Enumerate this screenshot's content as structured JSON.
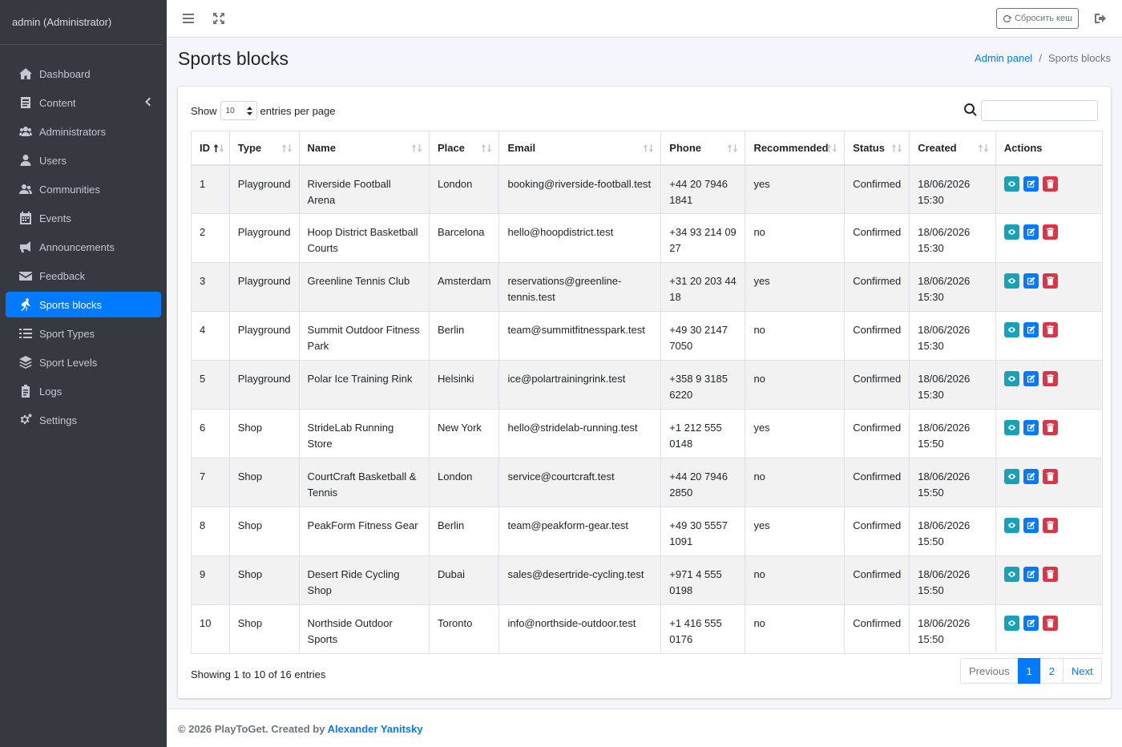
{
  "sidebar": {
    "user": "admin (Administrator)",
    "items": [
      {
        "label": "Dashboard",
        "icon": "home-icon"
      },
      {
        "label": "Content",
        "icon": "content-icon"
      },
      {
        "label": "Administrators",
        "icon": "users-cog-icon"
      },
      {
        "label": "Users",
        "icon": "user-icon"
      },
      {
        "label": "Communities",
        "icon": "users-icon"
      },
      {
        "label": "Events",
        "icon": "calendar-icon"
      },
      {
        "label": "Announcements",
        "icon": "bullhorn-icon"
      },
      {
        "label": "Feedback",
        "icon": "envelope-icon"
      },
      {
        "label": "Sports blocks",
        "icon": "running-icon"
      },
      {
        "label": "Sport Types",
        "icon": "list-icon"
      },
      {
        "label": "Sport Levels",
        "icon": "layers-icon"
      },
      {
        "label": "Logs",
        "icon": "clipboard-icon"
      },
      {
        "label": "Settings",
        "icon": "cogs-icon"
      }
    ]
  },
  "topbar": {
    "cache_button": "Сбросить кеш"
  },
  "header": {
    "title": "Sports blocks",
    "breadcrumb": {
      "link": "Admin panel",
      "separator": "/",
      "current": "Sports blocks"
    }
  },
  "table_controls": {
    "show": "Show",
    "entries_value": "10",
    "entries_suffix": "entries per page"
  },
  "table": {
    "columns": [
      "ID",
      "Type",
      "Name",
      "Place",
      "Email",
      "Phone",
      "Recommended",
      "Status",
      "Created",
      "Actions"
    ],
    "rows": [
      {
        "id": "1",
        "type": "Playground",
        "name": "Riverside Football Arena",
        "place": "London",
        "email": "booking@riverside-football.test",
        "phone": "+44 20 7946 1841",
        "recommended": "yes",
        "status": "Confirmed",
        "created": "18/06/2026 15:30"
      },
      {
        "id": "2",
        "type": "Playground",
        "name": "Hoop District Basketball Courts",
        "place": "Barcelona",
        "email": "hello@hoopdistrict.test",
        "phone": "+34 93 214 09 27",
        "recommended": "no",
        "status": "Confirmed",
        "created": "18/06/2026 15:30"
      },
      {
        "id": "3",
        "type": "Playground",
        "name": "Greenline Tennis Club",
        "place": "Amsterdam",
        "email": "reservations@greenline-tennis.test",
        "phone": "+31 20 203 44 18",
        "recommended": "yes",
        "status": "Confirmed",
        "created": "18/06/2026 15:30"
      },
      {
        "id": "4",
        "type": "Playground",
        "name": "Summit Outdoor Fitness Park",
        "place": "Berlin",
        "email": "team@summitfitnesspark.test",
        "phone": "+49 30 2147 7050",
        "recommended": "no",
        "status": "Confirmed",
        "created": "18/06/2026 15:30"
      },
      {
        "id": "5",
        "type": "Playground",
        "name": "Polar Ice Training Rink",
        "place": "Helsinki",
        "email": "ice@polartrainingrink.test",
        "phone": "+358 9 3185 6220",
        "recommended": "no",
        "status": "Confirmed",
        "created": "18/06/2026 15:30"
      },
      {
        "id": "6",
        "type": "Shop",
        "name": "StrideLab Running Store",
        "place": "New York",
        "email": "hello@stridelab-running.test",
        "phone": "+1 212 555 0148",
        "recommended": "yes",
        "status": "Confirmed",
        "created": "18/06/2026 15:50"
      },
      {
        "id": "7",
        "type": "Shop",
        "name": "CourtCraft Basketball & Tennis",
        "place": "London",
        "email": "service@courtcraft.test",
        "phone": "+44 20 7946 2850",
        "recommended": "no",
        "status": "Confirmed",
        "created": "18/06/2026 15:50"
      },
      {
        "id": "8",
        "type": "Shop",
        "name": "PeakForm Fitness Gear",
        "place": "Berlin",
        "email": "team@peakform-gear.test",
        "phone": "+49 30 5557 1091",
        "recommended": "yes",
        "status": "Confirmed",
        "created": "18/06/2026 15:50"
      },
      {
        "id": "9",
        "type": "Shop",
        "name": "Desert Ride Cycling Shop",
        "place": "Dubai",
        "email": "sales@desertride-cycling.test",
        "phone": "+971 4 555 0198",
        "recommended": "no",
        "status": "Confirmed",
        "created": "18/06/2026 15:50"
      },
      {
        "id": "10",
        "type": "Shop",
        "name": "Northside Outdoor Sports",
        "place": "Toronto",
        "email": "info@northside-outdoor.test",
        "phone": "+1 416 555 0176",
        "recommended": "no",
        "status": "Confirmed",
        "created": "18/06/2026 15:50"
      }
    ]
  },
  "footer_info": "Showing 1 to 10 of 16 entries",
  "pagination": {
    "previous": "Previous",
    "pages": [
      "1",
      "2"
    ],
    "next": "Next"
  },
  "footer": {
    "text": "© 2026 PlayToGet. Created by",
    "author": "Alexander Yanitsky"
  },
  "colors": {
    "sidebar_bg": "#343a40",
    "accent": "#007bff",
    "view": "#17a2b8",
    "delete": "#dc3545"
  }
}
